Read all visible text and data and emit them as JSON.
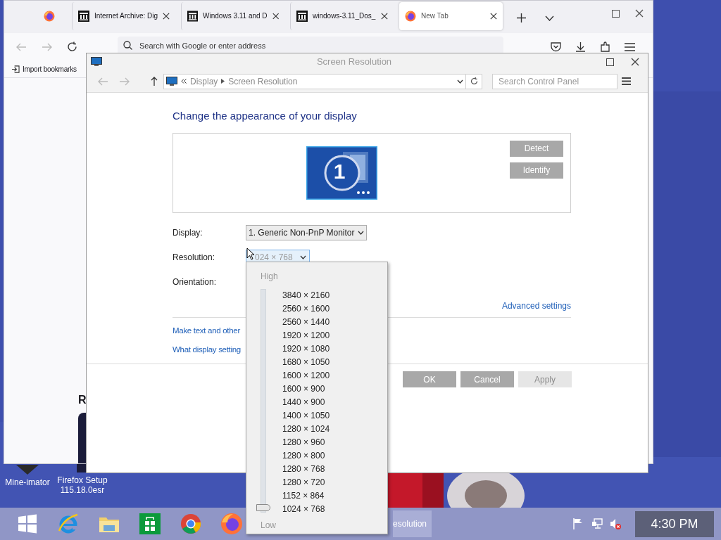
{
  "browser": {
    "tabs": [
      {
        "kind": "pinned",
        "selected": false
      },
      {
        "kind": "archive",
        "title": "Internet Archive: Dig",
        "selected": false
      },
      {
        "kind": "archive",
        "title": "Windows 3.11 and D",
        "selected": false
      },
      {
        "kind": "archive",
        "title": "windows-3.11_Dos_",
        "selected": false
      },
      {
        "kind": "firefox",
        "title": "New Tab",
        "selected": true
      }
    ],
    "address_placeholder": "Search with Google or enter address",
    "bookmarks": [
      "Import bookmarks"
    ],
    "page_heading": "R"
  },
  "window": {
    "title": "Screen Resolution",
    "breadcrumb": [
      "Display",
      "Screen Resolution"
    ],
    "search_placeholder": "Search Control Panel",
    "heading": "Change the appearance of your display",
    "monitor_number": "1",
    "side_buttons": [
      "Detect",
      "Identify"
    ],
    "fields": [
      {
        "label": "Display:",
        "value": "1. Generic Non-PnP Monitor"
      },
      {
        "label": "Resolution:",
        "value": "024 × 768"
      },
      {
        "label": "Orientation:"
      }
    ],
    "advanced_link": "Advanced settings",
    "links": [
      "Make text and other",
      "What display setting"
    ],
    "buttons": [
      {
        "label": "OK",
        "disabled": false
      },
      {
        "label": "Cancel",
        "disabled": false
      },
      {
        "label": "Apply",
        "disabled": true
      }
    ]
  },
  "resolution_popup": {
    "top_label": "High",
    "bottom_label": "Low",
    "level": 0,
    "options": [
      "3840 × 2160",
      "2560 × 1600",
      "2560 × 1440",
      "1920 × 1200",
      "1920 × 1080",
      "1680 × 1050",
      "1600 × 1200",
      "1600 × 900",
      "1440 × 900",
      "1400 × 1050",
      "1280 × 1024",
      "1280 × 960",
      "1280 × 800",
      "1280 × 768",
      "1280 × 720",
      "1152 × 864",
      "1024 × 768"
    ]
  },
  "desktop_icons": [
    {
      "kind": "app",
      "label": "Mine-imator"
    },
    {
      "kind": "setup",
      "label": "Firefox Setup 115.18.0esr"
    }
  ],
  "taskbar": {
    "apps": [
      {
        "kind": "start"
      },
      {
        "kind": "ie"
      },
      {
        "kind": "explorer"
      },
      {
        "kind": "store"
      },
      {
        "kind": "chrome"
      },
      {
        "kind": "firefox"
      }
    ],
    "window_button": "esolution",
    "clock": "4:30 PM"
  }
}
